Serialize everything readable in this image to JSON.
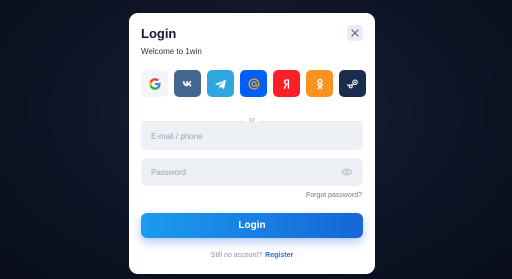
{
  "modal": {
    "title": "Login",
    "subtitle": "Welcome to 1win",
    "close_icon": "close-icon"
  },
  "socials": [
    {
      "name": "google",
      "icon": "google-icon",
      "color": "#f3f5f8"
    },
    {
      "name": "vk",
      "icon": "vk-icon",
      "color": "#45668e"
    },
    {
      "name": "telegram",
      "icon": "telegram-icon",
      "color": "#2ea6de"
    },
    {
      "name": "mail",
      "icon": "at-icon",
      "color": "#005ff9"
    },
    {
      "name": "yandex",
      "icon": "yandex-icon",
      "color": "#fc1f28"
    },
    {
      "name": "odnoklassniki",
      "icon": "ok-icon",
      "color": "#f7931e"
    },
    {
      "name": "steam",
      "icon": "steam-icon",
      "color": "#1b2d4d"
    }
  ],
  "divider": {
    "text": "or"
  },
  "form": {
    "email_placeholder": "E-mail / phone",
    "email_value": "",
    "password_placeholder": "Password",
    "password_value": "",
    "forgot_label": "Forgot password?",
    "submit_label": "Login"
  },
  "footer": {
    "prompt": "Still no account?",
    "register_label": "Register"
  },
  "colors": {
    "accent_start": "#1a9bf0",
    "accent_end": "#1666d6",
    "register_link": "#1f6fd9"
  }
}
